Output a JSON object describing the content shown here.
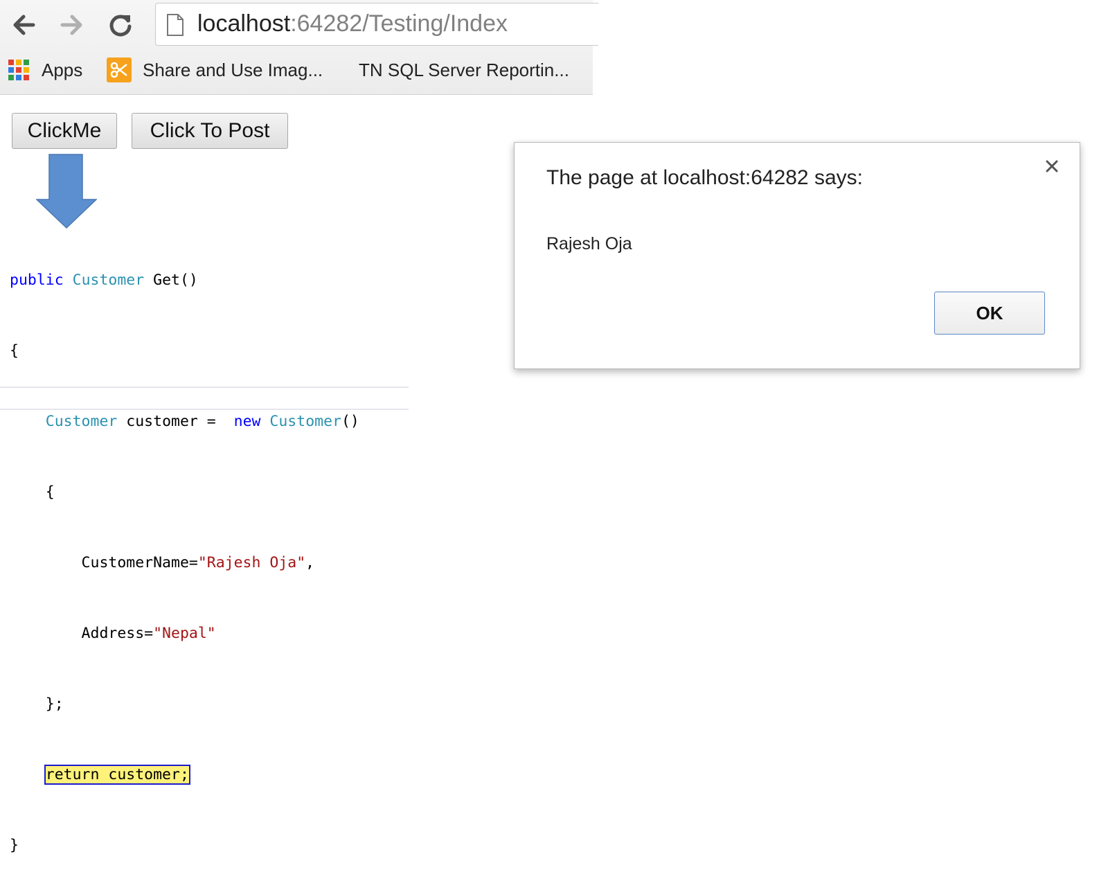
{
  "browser": {
    "url_host": "localhost",
    "url_path": ":64282/Testing/Index",
    "bookmarks": [
      {
        "label": "Apps",
        "icon": "apps-grid-icon"
      },
      {
        "label": "Share and Use Imag...",
        "icon": "scissors-icon"
      },
      {
        "label": "TN SQL Server Reportin...",
        "icon": ""
      }
    ]
  },
  "page": {
    "click_me_label": "ClickMe",
    "click_to_post_label": "Click To Post"
  },
  "code": {
    "line1": {
      "kw": "public",
      "type": "Customer",
      "rest": " Get()"
    },
    "line2": "{",
    "line3": {
      "type": "Customer",
      "mid": " customer =  ",
      "kw": "new",
      "type2": "Customer",
      "end": "()"
    },
    "line4": "    {",
    "line5": {
      "prop": "        CustomerName=",
      "str": "\"Rajesh Oja\"",
      "end": ","
    },
    "line6": {
      "prop": "        Address=",
      "str": "\"Nepal\""
    },
    "line7": "    };",
    "line8": "return customer;",
    "line9": "}"
  },
  "dialog": {
    "title": "The page at localhost:64282 says:",
    "message": "Rajesh Oja",
    "ok_label": "OK"
  },
  "colors": {
    "keyword": "#0000ff",
    "type": "#2b91af",
    "string": "#a31515",
    "highlight": "#fff27a",
    "arrow": "#5b8fd0"
  }
}
